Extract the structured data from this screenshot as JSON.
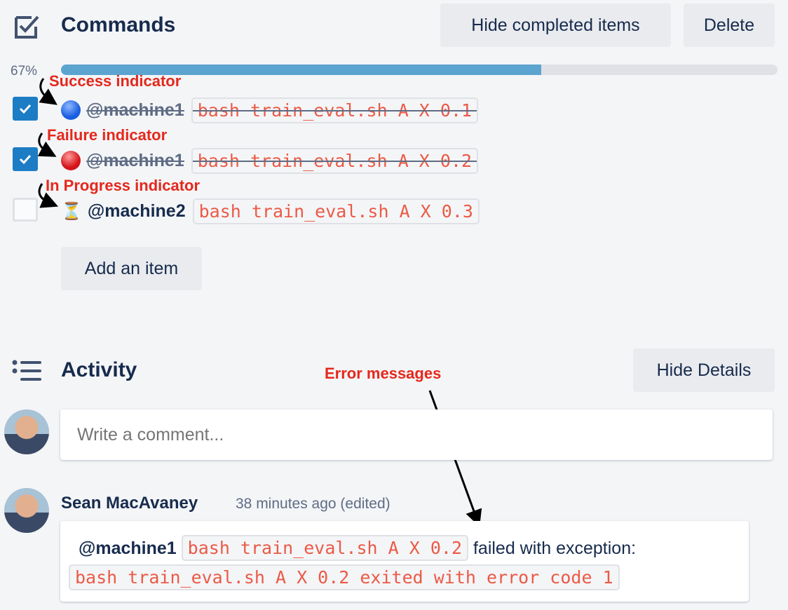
{
  "commands": {
    "title": "Commands",
    "hide_completed": "Hide completed items",
    "delete": "Delete",
    "progress_label": "67%",
    "progress": 0.67,
    "items": [
      {
        "machine": "@machine1",
        "command": "bash train_eval.sh A X 0.1",
        "checked": true,
        "status": "success",
        "status_color": "#1a5ee0"
      },
      {
        "machine": "@machine1",
        "command": "bash train_eval.sh A X 0.2",
        "checked": true,
        "status": "failure",
        "status_color": "#d4141a"
      },
      {
        "machine": "@machine2",
        "command": "bash train_eval.sh A X 0.3",
        "checked": false,
        "status": "in-progress",
        "status_icon": "⏳"
      }
    ],
    "add_item": "Add an item"
  },
  "annotations": {
    "success": "Success indicator",
    "failure": "Failure indicator",
    "in_progress": "In Progress indicator",
    "errors": "Error messages"
  },
  "activity": {
    "title": "Activity",
    "hide_details": "Hide Details",
    "comment_placeholder": "Write a comment...",
    "comment": {
      "author": "Sean MacAvaney",
      "time": "38 minutes ago (edited)",
      "machine": "@machine1",
      "command": "bash train_eval.sh A X 0.2",
      "text": "failed with exception:",
      "error": "bash train_eval.sh A X 0.2 exited with error code 1"
    }
  },
  "colors": {
    "accent": "#5ba4cf",
    "annotation": "#e5281c",
    "code": "#eb5a46"
  }
}
